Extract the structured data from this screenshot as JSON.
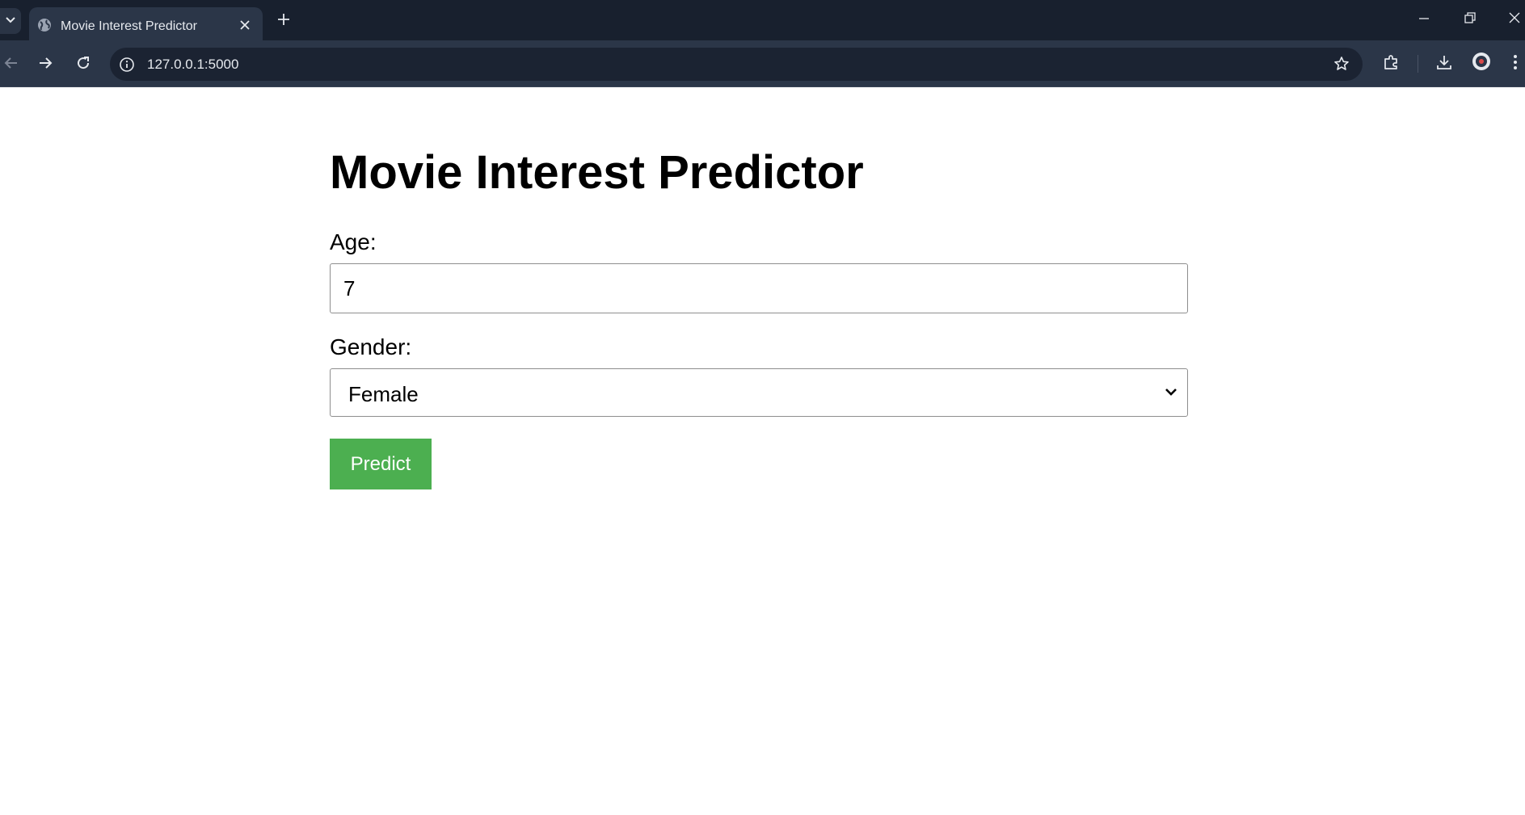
{
  "browser": {
    "tab_title": "Movie Interest Predictor",
    "url": "127.0.0.1:5000"
  },
  "page": {
    "title": "Movie Interest Predictor",
    "age_label": "Age:",
    "age_value": "7",
    "gender_label": "Gender:",
    "gender_selected": "Female",
    "predict_label": "Predict"
  },
  "colors": {
    "predict_button": "#4caf50",
    "chrome_dark": "#18202e",
    "chrome_toolbar": "#2b3648"
  }
}
